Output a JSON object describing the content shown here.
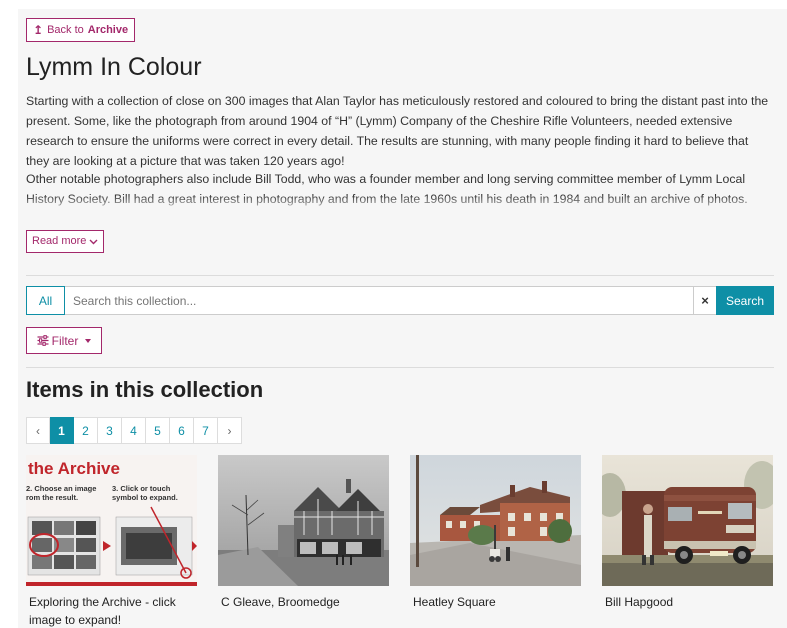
{
  "back": {
    "label_prefix": "Back to",
    "label_strong": "Archive"
  },
  "title": "Lymm In Colour",
  "description": {
    "p1": "Starting with a collection of close on 300 images that Alan Taylor has meticulously restored and coloured to bring the distant past into the present.  Some, like the photograph from around 1904 of “H” (Lymm) Company of the Cheshire Rifle Volunteers, needed extensive research to ensure the uniforms were correct in every detail. The results are stunning, with many people finding it hard to believe that they are looking at a picture that was taken 120 years ago!",
    "p2": "Other notable photographers also include Bill Todd, who was a founder member and long serving committee member of Lymm Local History Society. Bill had a great interest in photography and from the late 1960s until his death in 1984 and built an archive of photos."
  },
  "read_more": "Read more",
  "search": {
    "scope": "All",
    "placeholder": "Search this collection...",
    "clear": "×",
    "button": "Search"
  },
  "filter": {
    "label": "Filter"
  },
  "items_title": "Items in this collection",
  "pagination": {
    "prev": "‹",
    "next": "›",
    "pages": [
      "1",
      "2",
      "3",
      "4",
      "5",
      "6",
      "7"
    ],
    "current": "1"
  },
  "items": [
    {
      "caption": "Exploring the Archive - click image to expand!",
      "thumb_text": {
        "headline": "the Archive",
        "step2": "2. Choose an image",
        "step2b": "rom the result.",
        "step3": "3. Click or touch",
        "step3b": "symbol to expand."
      }
    },
    {
      "caption": "C Gleave, Broomedge"
    },
    {
      "caption": "Heatley Square"
    },
    {
      "caption": "Bill Hapgood"
    }
  ],
  "colors": {
    "brand": "#a3286b",
    "accent": "#0e8fa6",
    "background": "#f6f6f6"
  }
}
